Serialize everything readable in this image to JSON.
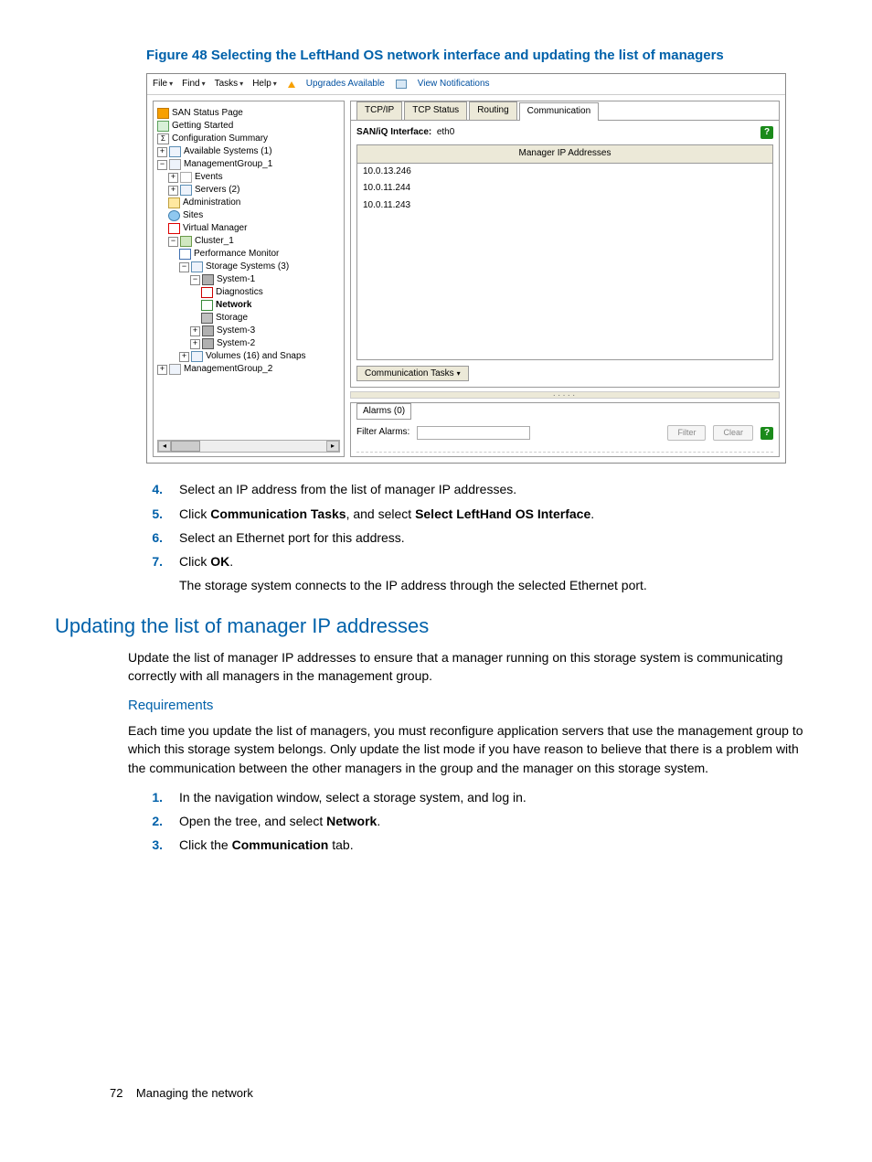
{
  "figure_caption": "Figure 48 Selecting the LeftHand OS network interface and updating the list of managers",
  "menubar": {
    "file": "File",
    "find": "Find",
    "tasks": "Tasks",
    "help": "Help",
    "upgrades": "Upgrades Available",
    "notifications": "View Notifications"
  },
  "tree": {
    "san_status": "SAN Status Page",
    "getting_started": "Getting Started",
    "config_summary": "Configuration Summary",
    "available_systems": "Available Systems (1)",
    "mg1": "ManagementGroup_1",
    "events": "Events",
    "servers": "Servers (2)",
    "administration": "Administration",
    "sites": "Sites",
    "virtual_manager": "Virtual Manager",
    "cluster1": "Cluster_1",
    "perf_monitor": "Performance Monitor",
    "storage_systems": "Storage Systems (3)",
    "system1": "System-1",
    "diagnostics": "Diagnostics",
    "network": "Network",
    "storage": "Storage",
    "system3": "System-3",
    "system2": "System-2",
    "volumes": "Volumes (16) and Snaps",
    "mg2": "ManagementGroup_2"
  },
  "tabs": {
    "tcpip": "TCP/IP",
    "tcp_status": "TCP Status",
    "routing": "Routing",
    "communication": "Communication"
  },
  "interface_label": "SAN/iQ Interface:",
  "interface_value": "eth0",
  "ip_header": "Manager IP Addresses",
  "ips": [
    "10.0.13.246",
    "10.0.11.244",
    "10.0.11.243"
  ],
  "comm_tasks_btn": "Communication Tasks",
  "alarms_tab": "Alarms (0)",
  "filter_label": "Filter Alarms:",
  "filter_btn": "Filter",
  "clear_btn": "Clear",
  "steps1": {
    "s4": "Select an IP address from the list of manager IP addresses.",
    "s5_a": "Click ",
    "s5_b": "Communication Tasks",
    "s5_c": ", and select ",
    "s5_d": "Select LeftHand OS Interface",
    "s5_e": ".",
    "s6": "Select an Ethernet port for this address.",
    "s7_a": "Click ",
    "s7_b": "OK",
    "s7_c": ".",
    "follow": "The storage system connects to the IP address through the selected Ethernet port."
  },
  "heading2": "Updating the list of manager IP addresses",
  "para1": "Update the list of manager IP addresses to ensure that a manager running on this storage system is communicating correctly with all managers in the management group.",
  "heading3": "Requirements",
  "para2": "Each time you update the list of managers, you must reconfigure application servers that use the management group to which this storage system belongs. Only update the list mode if you have reason to believe that there is a problem with the communication between the other managers in the group and the manager on this storage system.",
  "steps2": {
    "s1": "In the navigation window, select a storage system, and log in.",
    "s2_a": "Open the tree, and select ",
    "s2_b": "Network",
    "s2_c": ".",
    "s3_a": "Click the ",
    "s3_b": "Communication",
    "s3_c": " tab."
  },
  "footer_page": "72",
  "footer_text": "Managing the network"
}
